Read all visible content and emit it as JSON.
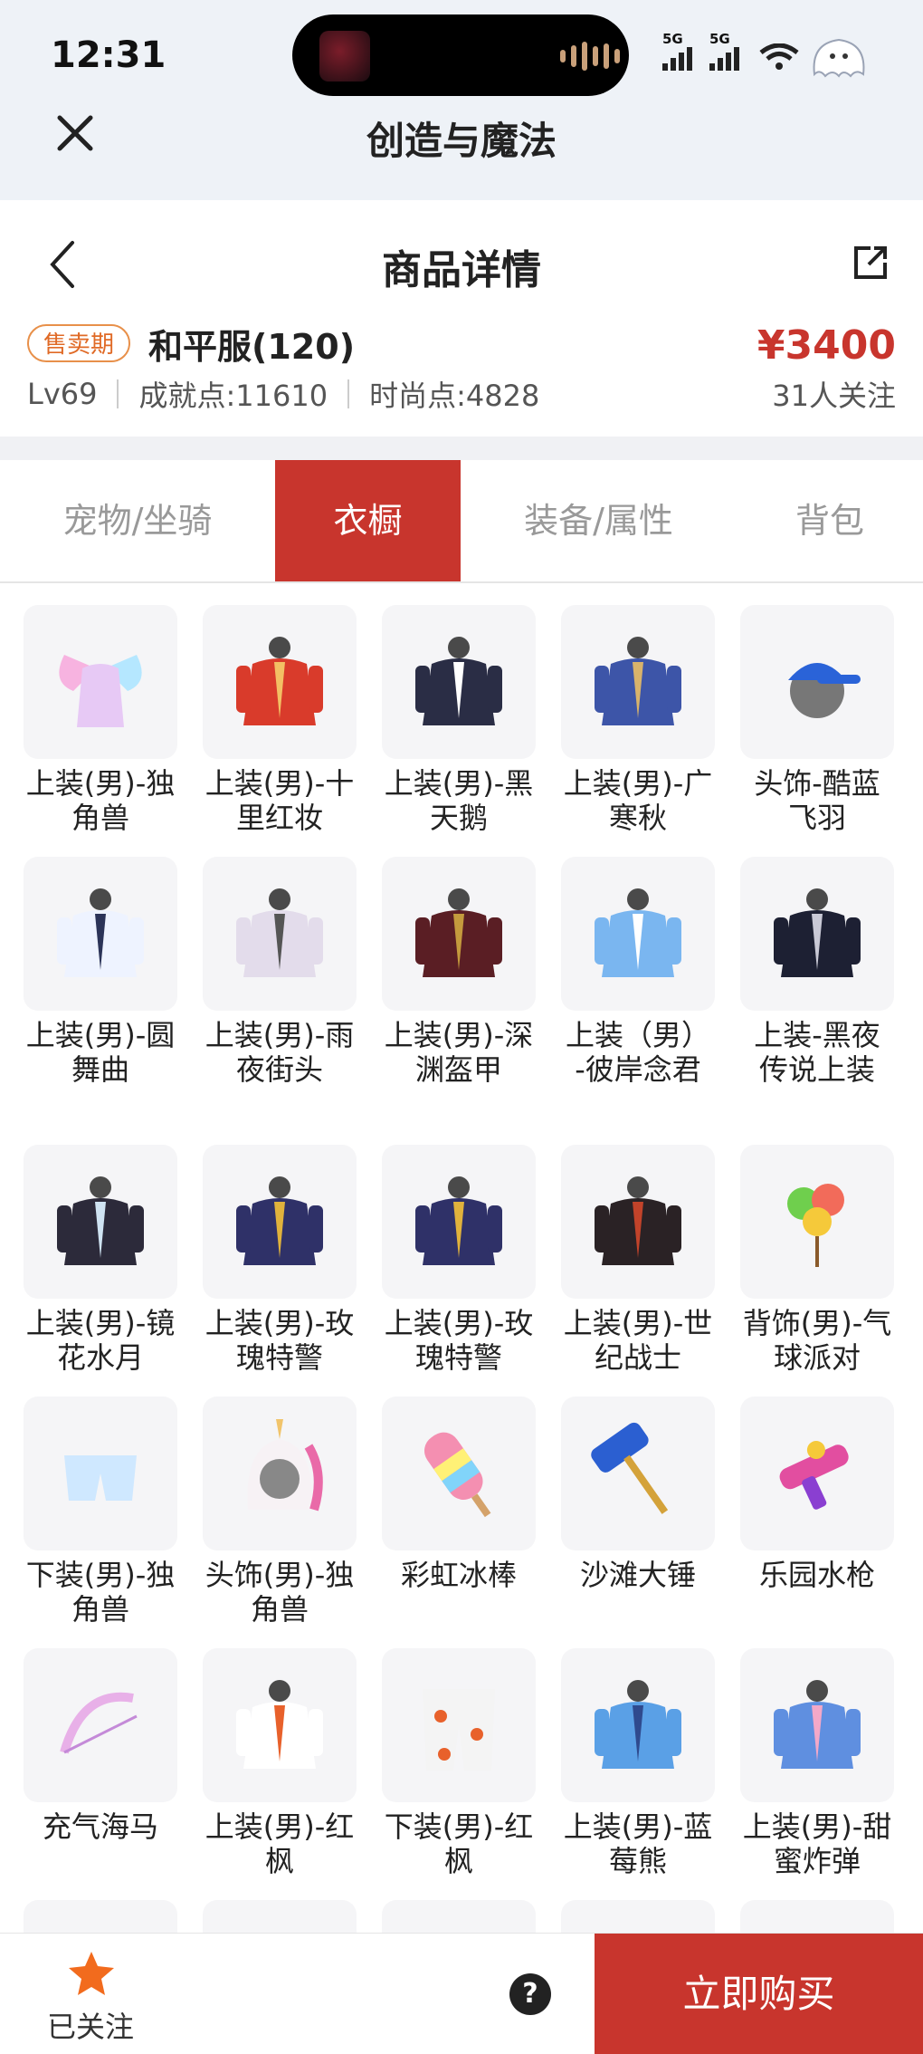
{
  "status_bar": {
    "time": "12:31",
    "network_1": "5G",
    "network_2": "5G"
  },
  "app": {
    "title": "创造与魔法"
  },
  "page": {
    "title": "商品详情"
  },
  "summary": {
    "badge": "售卖期",
    "server": "和平服(120)",
    "price": "¥3400",
    "level": "Lv69",
    "achievement": "成就点:11610",
    "fashion": "时尚点:4828",
    "followers": "31人关注"
  },
  "tabs": [
    {
      "label": "宠物/坐骑",
      "active": false
    },
    {
      "label": "衣橱",
      "active": true
    },
    {
      "label": "装备/属性",
      "active": false
    },
    {
      "label": "背包",
      "active": false
    }
  ],
  "items": [
    {
      "name": "上装(男)-独角兽",
      "icon": "unicorn-wing-outfit-icon"
    },
    {
      "name": "上装(男)-十里红妆",
      "icon": "red-robe-outfit-icon"
    },
    {
      "name": "上装(男)-黑天鹅",
      "icon": "black-swan-coat-icon"
    },
    {
      "name": "上装(男)-广寒秋",
      "icon": "blue-armor-outfit-icon"
    },
    {
      "name": "头饰-酷蓝飞羽",
      "icon": "blue-cap-headwear-icon"
    },
    {
      "name": "上装(男)-圆舞曲",
      "icon": "waltz-suit-icon"
    },
    {
      "name": "上装(男)-雨夜街头",
      "icon": "street-jacket-icon"
    },
    {
      "name": "上装(男)-深渊盔甲",
      "icon": "abyss-armor-icon"
    },
    {
      "name": "上装（男）-彼岸念君",
      "icon": "light-blue-robe-icon"
    },
    {
      "name": "上装-黑夜传说上装",
      "icon": "night-legend-coat-icon"
    },
    {
      "name": "上装(男)-镜花水月",
      "icon": "mirror-flower-coat-icon"
    },
    {
      "name": "上装(男)-玫瑰特警",
      "icon": "rose-police-uniform-icon"
    },
    {
      "name": "上装(男)-玫瑰特警",
      "icon": "rose-police-uniform-icon"
    },
    {
      "name": "上装(男)-世纪战士",
      "icon": "century-warrior-coat-icon"
    },
    {
      "name": "背饰(男)-气球派对",
      "icon": "balloon-party-back-icon"
    },
    {
      "name": "下装(男)-独角兽",
      "icon": "unicorn-pants-icon"
    },
    {
      "name": "头饰(男)-独角兽",
      "icon": "unicorn-hood-icon"
    },
    {
      "name": "彩虹冰棒",
      "icon": "rainbow-popsicle-icon"
    },
    {
      "name": "沙滩大锤",
      "icon": "beach-hammer-icon"
    },
    {
      "name": "乐园水枪",
      "icon": "water-gun-icon"
    },
    {
      "name": "充气海马",
      "icon": "inflatable-seahorse-icon"
    },
    {
      "name": "上装(男)-红枫",
      "icon": "red-maple-coat-icon"
    },
    {
      "name": "下装(男)-红枫",
      "icon": "red-maple-pants-icon"
    },
    {
      "name": "上装(男)-蓝莓熊",
      "icon": "blueberry-bear-coat-icon"
    },
    {
      "name": "上装(男)-甜蜜炸弹",
      "icon": "sweet-bomb-coat-icon"
    }
  ],
  "bottom_bar": {
    "follow_label": "已关注",
    "help": "?",
    "buy_label": "立即购买"
  },
  "colors": {
    "accent": "#c8352d",
    "badge": "#e06a26"
  }
}
